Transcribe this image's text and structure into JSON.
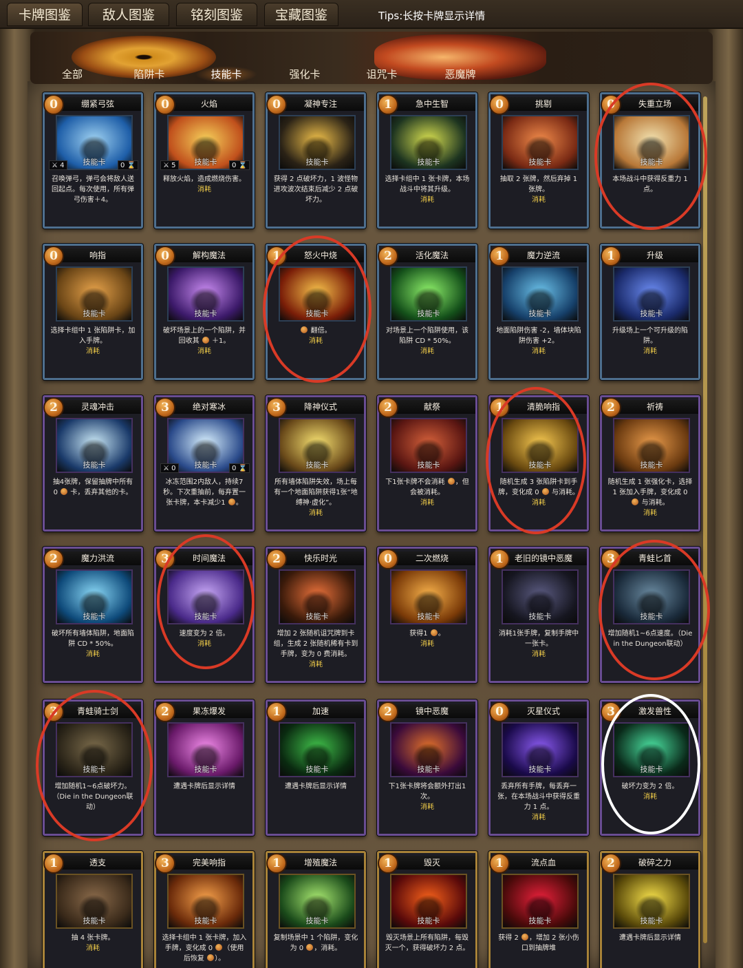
{
  "top_tabs": [
    "卡牌图鉴",
    "敌人图鉴",
    "铭刻图鉴",
    "宝藏图鉴"
  ],
  "tips": "Tips:长按卡牌显示详情",
  "filters": [
    "全部",
    "陷阱卡",
    "技能卡",
    "强化卡",
    "诅咒卡",
    "恶魔牌"
  ],
  "active_filter": "技能卡",
  "card_type_label": "技能卡",
  "consume_label": "消耗",
  "cards": [
    {
      "name": "绷紧弓弦",
      "cost": "0",
      "stat_left": "4",
      "stat_right": "0",
      "desc": "召唤弹弓，弹弓会将敌人送回起点。每次使用，所有弹弓伤害＋4。",
      "consume": ""
    },
    {
      "name": "火焰",
      "cost": "0",
      "stat_left": "5",
      "stat_right": "0",
      "desc": "释放火焰，造成燃烧伤害。",
      "consume": "消耗"
    },
    {
      "name": "凝神专注",
      "cost": "0",
      "desc": "获得 2 点破坏力，1 波怪物进攻波次结束后减少 2 点破坏力。",
      "consume": ""
    },
    {
      "name": "急中生智",
      "cost": "1",
      "desc": "选择卡组中 1 张卡牌，本场战斗中将其升级。",
      "consume": "消耗"
    },
    {
      "name": "挑剔",
      "cost": "0",
      "desc": "抽取 2 张牌，然后弃掉 1 张牌。",
      "consume": "消耗"
    },
    {
      "name": "失重立场",
      "cost": "0",
      "desc": "本场战斗中获得反重力 1 点。",
      "consume": ""
    },
    {
      "name": "响指",
      "cost": "0",
      "desc": "选择卡组中 1 张陷阱卡，加入手牌。",
      "consume": "消耗"
    },
    {
      "name": "解构魔法",
      "cost": "0",
      "desc": "破坏场景上的一个陷阱，并回收其 ● ＋1。",
      "consume": "消耗"
    },
    {
      "name": "怒火中烧",
      "cost": "1",
      "desc": "● 翻倍。",
      "consume": "消耗"
    },
    {
      "name": "活化魔法",
      "cost": "2",
      "desc": "对场景上一个陷阱使用，该陷阱 CD * 50%。",
      "consume": "消耗"
    },
    {
      "name": "魔力逆流",
      "cost": "1",
      "desc": "地面陷阱伤害 -2，墙体块陷阱伤害 +2。",
      "consume": "消耗"
    },
    {
      "name": "升级",
      "cost": "1",
      "desc": "升级场上一个可升级的陷阱。",
      "consume": "消耗"
    },
    {
      "name": "灵魂冲击",
      "cost": "2",
      "desc": "抽4张牌，保留抽牌中所有 0 ● 卡，丢弃其他的卡。",
      "consume": ""
    },
    {
      "name": "绝对寒冰",
      "cost": "3",
      "stat_left": "0",
      "stat_right": "0",
      "desc": "冰冻范围2内敌人，持续7秒。下次重抽前，每弃置一张卡牌，本卡减少1 ●。",
      "consume": ""
    },
    {
      "name": "降神仪式",
      "cost": "3",
      "desc": "所有墙体陷阱失效，场上每有一个地面陷阱获得1张“地缚神·虚化”。",
      "consume": "消耗"
    },
    {
      "name": "献祭",
      "cost": "2",
      "desc": "下1张卡牌不会消耗 ●，但会被消耗。",
      "consume": "消耗"
    },
    {
      "name": "清脆响指",
      "cost": "1",
      "desc": "随机生成 3 张陷阱卡到手牌，变化成 0 ● 与消耗。",
      "consume": "消耗"
    },
    {
      "name": "祈祷",
      "cost": "2",
      "desc": "随机生成 1 张强化卡，选择 1 张加入手牌，变化成 0 ● 与消耗。",
      "consume": "消耗"
    },
    {
      "name": "魔力洪流",
      "cost": "2",
      "desc": "破坏所有墙体陷阱，地面陷阱 CD * 50%。",
      "consume": "消耗"
    },
    {
      "name": "时间魔法",
      "cost": "3",
      "desc": "速度变为 2 倍。",
      "consume": "消耗"
    },
    {
      "name": "快乐时光",
      "cost": "2",
      "desc": "增加 2 张随机诅咒牌到卡组，生成 2 张随机稀有卡到手牌，变为 0 费消耗。",
      "consume": "消耗"
    },
    {
      "name": "二次燃烧",
      "cost": "0",
      "desc": "获得1 ●。",
      "consume": "消耗"
    },
    {
      "name": "老旧的镜中恶魔",
      "cost": "1",
      "desc": "消耗1张手牌，复制手牌中一张卡。",
      "consume": "消耗"
    },
    {
      "name": "青蛙匕首",
      "cost": "3",
      "desc": "增加随机1~6点速度。（Die in the Dungeon联动）",
      "consume": ""
    },
    {
      "name": "青蛙骑士剑",
      "cost": "3",
      "desc": "增加随机1~6点破坏力。（Die in the Dungeon联动）",
      "consume": ""
    },
    {
      "name": "果冻爆发",
      "cost": "2",
      "desc": "遭遇卡牌后显示详情",
      "consume": ""
    },
    {
      "name": "加速",
      "cost": "1",
      "desc": "遭遇卡牌后显示详情",
      "consume": ""
    },
    {
      "name": "镜中恶魔",
      "cost": "2",
      "desc": "下1张卡牌将会额外打出1次。",
      "consume": "消耗"
    },
    {
      "name": "灭星仪式",
      "cost": "0",
      "desc": "丢弃所有手牌，每丢弃一张，在本场战斗中获得反重力 1 点。",
      "consume": "消耗"
    },
    {
      "name": "激发兽性",
      "cost": "3",
      "desc": "破坏力变为 2 倍。",
      "consume": "消耗"
    },
    {
      "name": "透支",
      "cost": "1",
      "desc": "抽 4 张卡牌。",
      "consume": "消耗"
    },
    {
      "name": "完美响指",
      "cost": "3",
      "desc": "选择卡组中 1 张卡牌，加入手牌，变化成 0 ●（使用后恢复 ●）。",
      "consume": ""
    },
    {
      "name": "增殖魔法",
      "cost": "1",
      "desc": "复制场景中 1 个陷阱，变化为 0 ●，消耗。",
      "consume": ""
    },
    {
      "name": "毁灭",
      "cost": "1",
      "desc": "毁灭场景上所有陷阱，每毁灭一个，获得破坏力 2 点。",
      "consume": ""
    },
    {
      "name": "流点血",
      "cost": "1",
      "desc": "获得 2 ●，增加 2 张小伤口到抽牌堆",
      "consume": ""
    },
    {
      "name": "破碎之力",
      "cost": "2",
      "desc": "遭遇卡牌后显示详情",
      "consume": ""
    }
  ],
  "colors": {
    "accent": "#d08c1c",
    "highlight_red": "#d93a26",
    "highlight_white": "#ffffff",
    "consume": "#f5d04a"
  }
}
